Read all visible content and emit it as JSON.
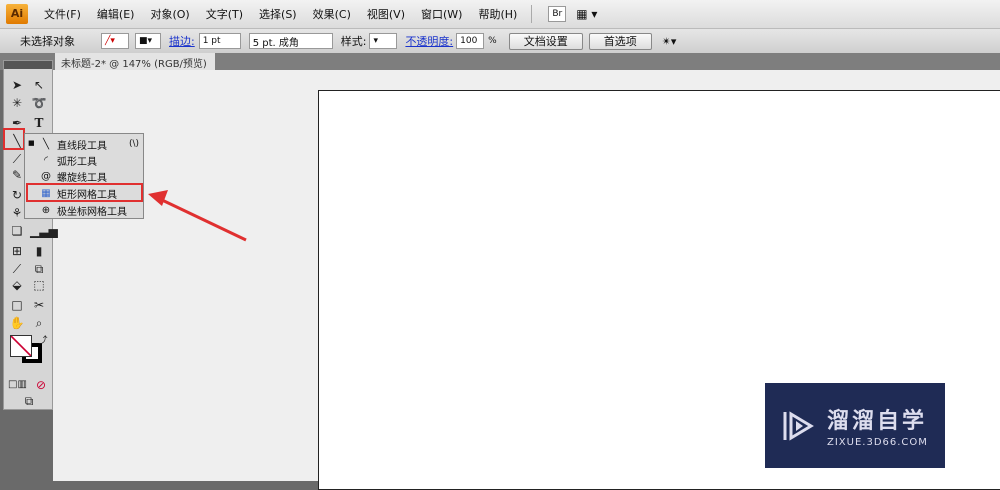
{
  "app": {
    "logo": "Ai"
  },
  "menu": [
    "文件(F)",
    "编辑(E)",
    "对象(O)",
    "文字(T)",
    "选择(S)",
    "效果(C)",
    "视图(V)",
    "窗口(W)",
    "帮助(H)"
  ],
  "menu_extra": {
    "bridge": "Br"
  },
  "control": {
    "selection": "未选择对象",
    "stroke_label": "描边:",
    "stroke_value": "1 pt",
    "brush": "5 pt. 成角",
    "style_label": "样式:",
    "opacity_label": "不透明度:",
    "opacity_value": "100",
    "percent": "%",
    "doc_setup": "文档设置",
    "preferences": "首选项"
  },
  "tab": {
    "title": "未标题-2* @ 147% (RGB/预览)",
    "close": "×"
  },
  "flyout": {
    "items": [
      {
        "label": "直线段工具",
        "shortcut": "(\\)",
        "icon": "line-segment-icon"
      },
      {
        "label": "弧形工具",
        "icon": "arc-icon"
      },
      {
        "label": "螺旋线工具",
        "icon": "spiral-icon"
      },
      {
        "label": "矩形网格工具",
        "icon": "rectangular-grid-icon"
      },
      {
        "label": "极坐标网格工具",
        "icon": "polar-grid-icon"
      }
    ]
  },
  "watermark": {
    "name": "溜溜自学",
    "url": "ZIXUE.3D66.COM"
  },
  "colors": {
    "highlight": "#e03030",
    "watermark_bg": "#1f2b55"
  }
}
